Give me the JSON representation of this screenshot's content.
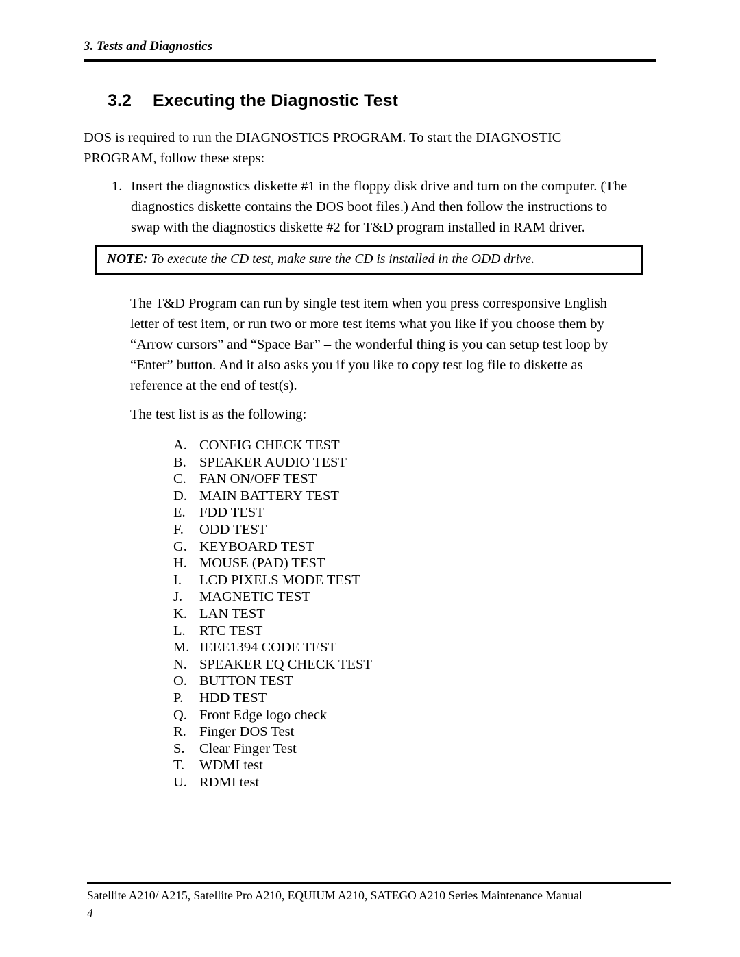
{
  "header": {
    "running_head": "3.  Tests and Diagnostics"
  },
  "section": {
    "number": "3.2",
    "title": "Executing the Diagnostic Test"
  },
  "body": {
    "intro": "DOS is required to run the DIAGNOSTICS PROGRAM.  To start the DIAGNOSTIC PROGRAM, follow these steps:",
    "steps": [
      {
        "marker": "1.",
        "text": "Insert the diagnostics diskette #1 in the floppy disk drive and turn on the computer.  (The diagnostics diskette contains the DOS boot files.) And then follow the instructions to swap with the diagnostics diskette #2 for T&D program installed in RAM driver."
      }
    ],
    "note": {
      "label": "NOTE:",
      "text": "To execute the CD test, make sure the CD is installed in the ODD drive."
    },
    "td_paragraph": "The T&D Program can run by single test item when you press corresponsive English letter of test item, or run two or more test items what you like if you choose them by “Arrow cursors” and “Space Bar” – the wonderful thing is you can setup test loop by “Enter” button. And it also asks you if you like to copy test log file to diskette as reference at the end of test(s).",
    "testlist_intro": "The test list is as the following:"
  },
  "test_list": [
    {
      "letter": "A.",
      "label": "CONFIG CHECK TEST"
    },
    {
      "letter": "B.",
      "label": "SPEAKER AUDIO TEST"
    },
    {
      "letter": "C.",
      "label": "FAN ON/OFF TEST"
    },
    {
      "letter": "D.",
      "label": "MAIN BATTERY TEST"
    },
    {
      "letter": "E.",
      "label": "FDD TEST"
    },
    {
      "letter": "F.",
      "label": "ODD TEST"
    },
    {
      "letter": "G.",
      "label": "KEYBOARD TEST"
    },
    {
      "letter": "H.",
      "label": "MOUSE (PAD) TEST"
    },
    {
      "letter": "I.",
      "label": "LCD PIXELS MODE TEST"
    },
    {
      "letter": "J.",
      "label": "MAGNETIC TEST"
    },
    {
      "letter": "K.",
      "label": "LAN TEST"
    },
    {
      "letter": "L.",
      "label": "RTC TEST"
    },
    {
      "letter": "M.",
      "label": "IEEE1394 CODE TEST"
    },
    {
      "letter": "N.",
      "label": "SPEAKER EQ CHECK TEST"
    },
    {
      "letter": "O.",
      "label": " BUTTON TEST"
    },
    {
      "letter": "P.",
      "label": "HDD TEST"
    },
    {
      "letter": "Q.",
      "label": "Front Edge logo check"
    },
    {
      "letter": "R.",
      "label": "Finger DOS Test"
    },
    {
      "letter": "S.",
      "label": "Clear Finger Test"
    },
    {
      "letter": "T.",
      "label": "WDMI test"
    },
    {
      "letter": "U.",
      "label": "RDMI test"
    }
  ],
  "footer": {
    "manual_line": "Satellite A210/ A215, Satellite Pro A210, EQUIUM A210, SATEGO A210 Series Maintenance Manual",
    "page_number": "4"
  }
}
